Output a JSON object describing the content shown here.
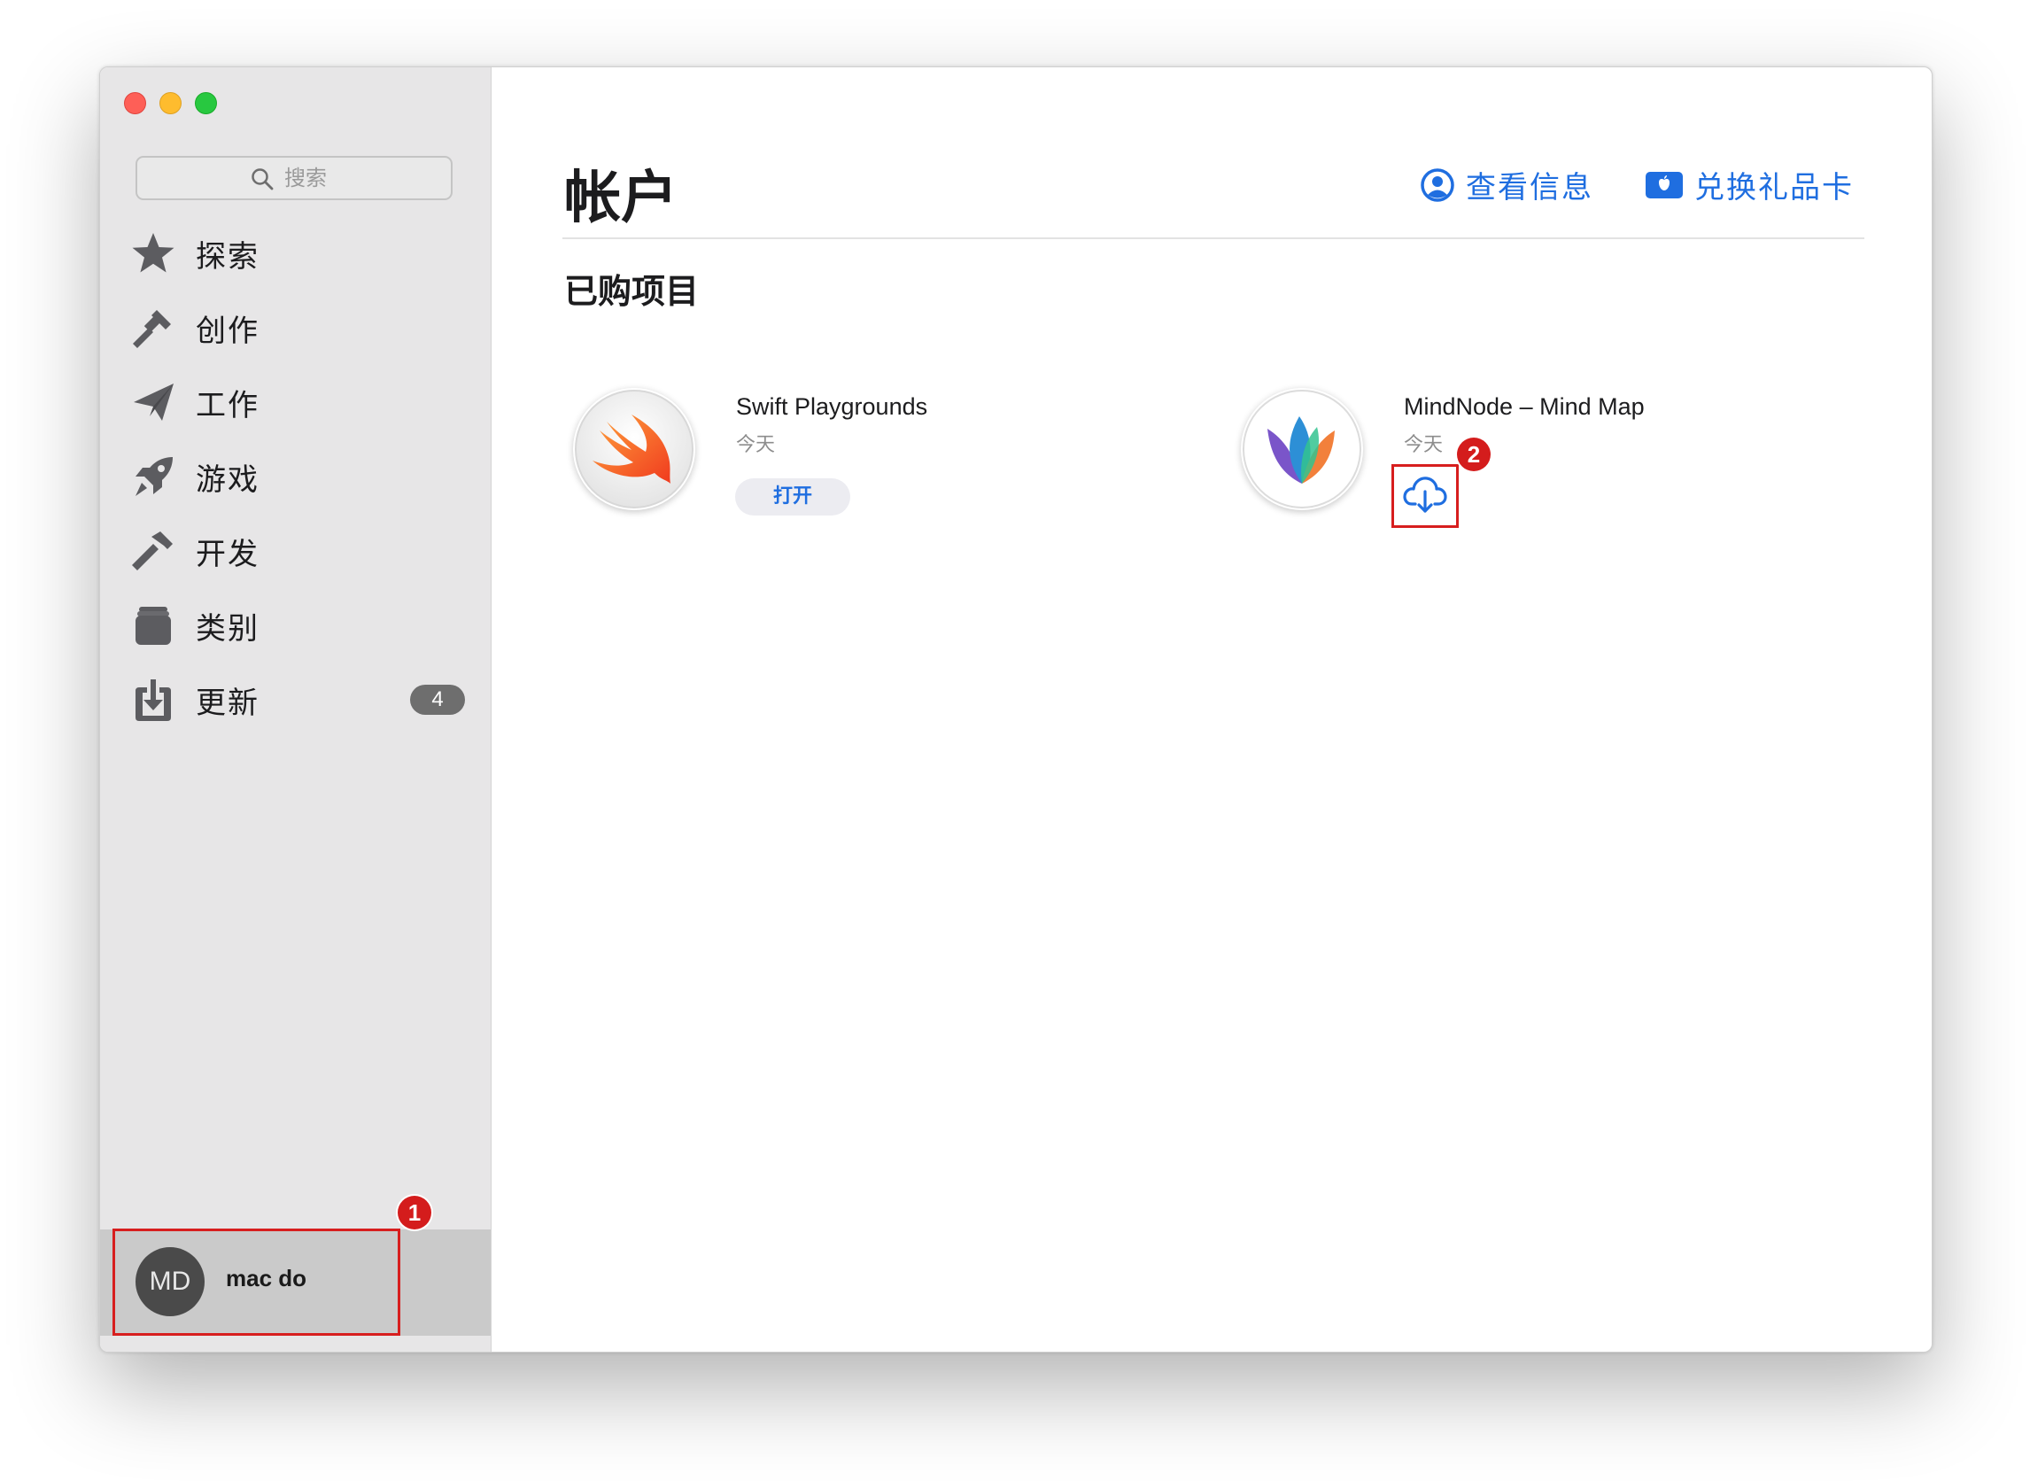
{
  "window": {
    "traffic_lights": [
      "close",
      "minimize",
      "zoom"
    ]
  },
  "sidebar": {
    "search": {
      "placeholder": "搜索",
      "value": "",
      "icon": "search-icon"
    },
    "items": [
      {
        "label": "探索",
        "icon": "star-icon"
      },
      {
        "label": "创作",
        "icon": "brush-icon"
      },
      {
        "label": "工作",
        "icon": "paper-plane-icon"
      },
      {
        "label": "游戏",
        "icon": "rocket-icon"
      },
      {
        "label": "开发",
        "icon": "hammer-icon"
      },
      {
        "label": "类别",
        "icon": "stack-icon"
      },
      {
        "label": "更新",
        "icon": "download-icon",
        "badge": "4"
      }
    ],
    "account": {
      "initials": "MD",
      "name": "mac do"
    }
  },
  "main": {
    "title": "帐户",
    "view_info": {
      "label": "查看信息",
      "icon": "person-circle-icon"
    },
    "redeem": {
      "label": "兑换礼品卡",
      "icon": "gift-card-icon"
    },
    "section_title": "已购项目",
    "apps": [
      {
        "name": "Swift Playgrounds",
        "date": "今天",
        "action_label": "打开",
        "icon": "swift-icon"
      },
      {
        "name": "MindNode – Mind Map",
        "date": "今天",
        "action": "download",
        "icon": "mindnode-icon"
      }
    ]
  },
  "annotations": [
    {
      "number": "1"
    },
    {
      "number": "2"
    }
  ],
  "colors": {
    "accent": "#1f6ee0",
    "highlight": "#d71e1e",
    "sidebar_bg": "#e7e6e7"
  }
}
